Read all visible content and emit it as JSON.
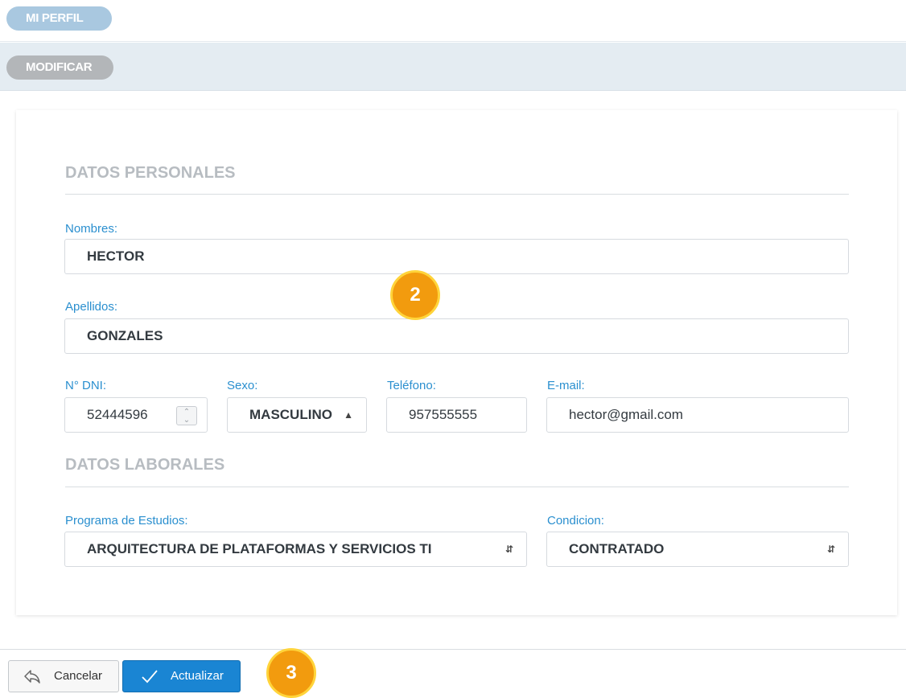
{
  "header": {
    "profile_label": "MI PERFIL",
    "modify_label": "MODIFICAR"
  },
  "personal": {
    "section_title": "DATOS PERSONALES",
    "nombres_label": "Nombres:",
    "nombres_value": "HECTOR",
    "apellidos_label": "Apellidos:",
    "apellidos_value": "GONZALES",
    "dni_label": "N° DNI:",
    "dni_value": "52444596",
    "sexo_label": "Sexo:",
    "sexo_value": "MASCULINO",
    "telefono_label": "Teléfono:",
    "telefono_value": "957555555",
    "email_label": "E-mail:",
    "email_value": "hector@gmail.com"
  },
  "laboral": {
    "section_title": "DATOS LABORALES",
    "programa_label": "Programa de Estudios:",
    "programa_value": "ARQUITECTURA DE PLATAFORMAS Y SERVICIOS TI",
    "condicion_label": "Condicion:",
    "condicion_value": "CONTRATADO"
  },
  "actions": {
    "cancel_label": "Cancelar",
    "update_label": "Actualizar"
  },
  "annotations": {
    "badge_2": "2",
    "badge_3": "3"
  },
  "colors": {
    "accent": "#1a85d3",
    "label_blue": "#2a8fcf",
    "badge_orange": "#f29b0e"
  }
}
